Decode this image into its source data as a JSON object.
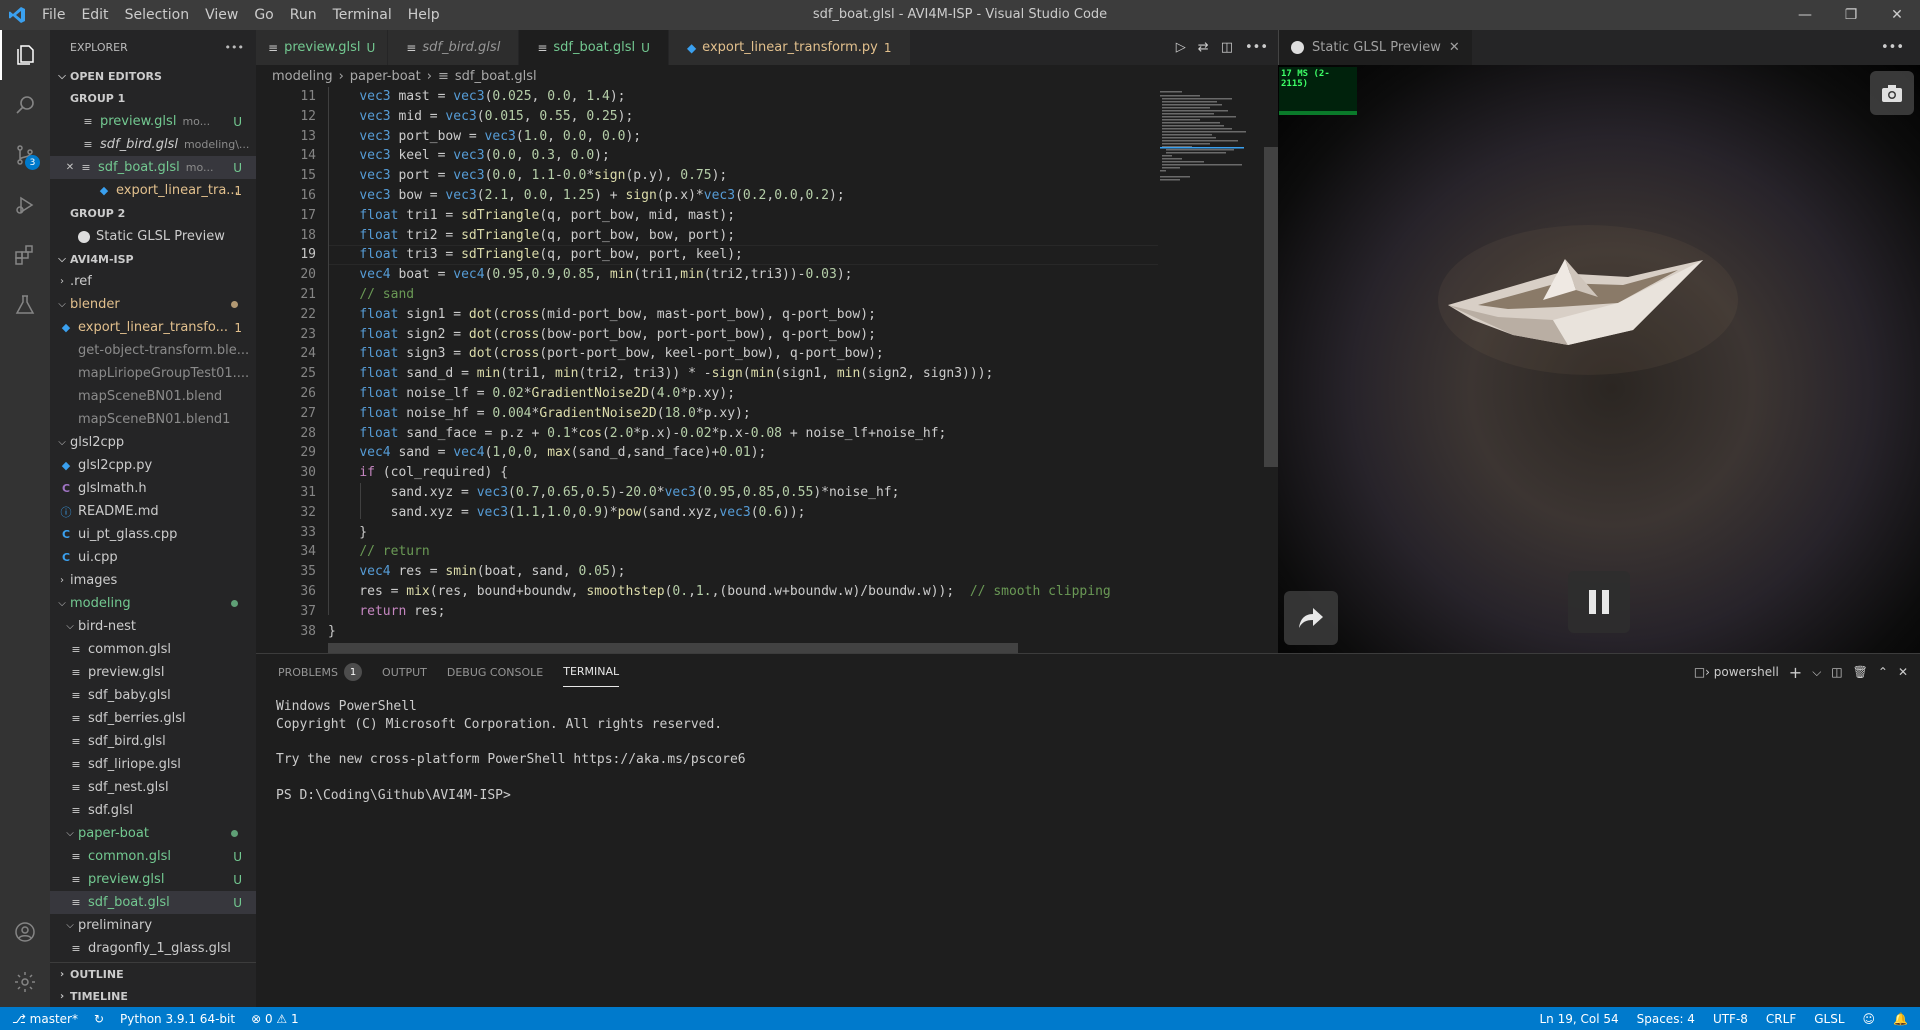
{
  "window": {
    "title": "sdf_boat.glsl - AVI4M-ISP - Visual Studio Code",
    "menu": [
      "File",
      "Edit",
      "Selection",
      "View",
      "Go",
      "Run",
      "Terminal",
      "Help"
    ]
  },
  "activity": {
    "scm_badge": "3"
  },
  "sidebar": {
    "title": "EXPLORER",
    "open_editors_label": "OPEN EDITORS",
    "group1_label": "GROUP 1",
    "group2_label": "GROUP 2",
    "open_editors": [
      {
        "name": "preview.glsl",
        "desc": "mo...",
        "badge": "U"
      },
      {
        "name": "sdf_bird.glsl",
        "desc": "modeling\\...",
        "badge": ""
      },
      {
        "name": "sdf_boat.glsl",
        "desc": "mo...",
        "badge": "U"
      },
      {
        "name": "export_linear_tra...",
        "desc": "",
        "badge": "1"
      }
    ],
    "group2_item": "Static GLSL Preview",
    "project_label": "AVI4M-ISP",
    "tree": [
      {
        "name": ".ref"
      },
      {
        "name": "blender"
      },
      {
        "name": "export_linear_transfo...",
        "badge": "1"
      },
      {
        "name": "get-object-transform.ble..."
      },
      {
        "name": "mapLiriopeGroupTest01...."
      },
      {
        "name": "mapSceneBN01.blend"
      },
      {
        "name": "mapSceneBN01.blend1"
      },
      {
        "name": "glsl2cpp"
      },
      {
        "name": "glsl2cpp.py"
      },
      {
        "name": "glslmath.h"
      },
      {
        "name": "README.md"
      },
      {
        "name": "ui_pt_glass.cpp"
      },
      {
        "name": "ui.cpp"
      },
      {
        "name": "images"
      },
      {
        "name": "modeling"
      },
      {
        "name": "bird-nest"
      },
      {
        "name": "common.glsl"
      },
      {
        "name": "preview.glsl"
      },
      {
        "name": "sdf_baby.glsl"
      },
      {
        "name": "sdf_berries.glsl"
      },
      {
        "name": "sdf_bird.glsl"
      },
      {
        "name": "sdf_liriope.glsl"
      },
      {
        "name": "sdf_nest.glsl"
      },
      {
        "name": "sdf.glsl"
      },
      {
        "name": "paper-boat"
      },
      {
        "name": "common.glsl",
        "badge": "U"
      },
      {
        "name": "preview.glsl",
        "badge": "U"
      },
      {
        "name": "sdf_boat.glsl",
        "badge": "U"
      },
      {
        "name": "preliminary"
      },
      {
        "name": "dragonfly_1_glass.glsl"
      }
    ],
    "outline_label": "OUTLINE",
    "timeline_label": "TIMELINE"
  },
  "tabs": [
    {
      "name": "preview.glsl",
      "mod": "U"
    },
    {
      "name": "sdf_bird.glsl",
      "mod": ""
    },
    {
      "name": "sdf_boat.glsl",
      "mod": "U"
    },
    {
      "name": "export_linear_transform.py",
      "mod": "1"
    }
  ],
  "breadcrumbs": [
    "modeling",
    "paper-boat",
    "sdf_boat.glsl"
  ],
  "code": {
    "line_numbers": [
      "11",
      "12",
      "13",
      "14",
      "15",
      "16",
      "17",
      "18",
      "19",
      "20",
      "21",
      "22",
      "23",
      "24",
      "25",
      "26",
      "27",
      "28",
      "29",
      "30",
      "31",
      "32",
      "33",
      "34",
      "35",
      "36",
      "37",
      "38"
    ],
    "current_line": "19",
    "lines": [
      "    vec3 mast = vec3(0.025, 0.0, 1.4);",
      "    vec3 mid = vec3(0.015, 0.55, 0.25);",
      "    vec3 port_bow = vec3(1.0, 0.0, 0.0);",
      "    vec3 keel = vec3(0.0, 0.3, 0.0);",
      "    vec3 port = vec3(0.0, 1.1-0.0*sign(p.y), 0.75);",
      "    vec3 bow = vec3(2.1, 0.0, 1.25) + sign(p.x)*vec3(0.2,0.0,0.2);",
      "    float tri1 = sdTriangle(q, port_bow, mid, mast);",
      "    float tri2 = sdTriangle(q, port_bow, bow, port);",
      "    float tri3 = sdTriangle(q, port_bow, port, keel);",
      "    vec4 boat = vec4(0.95,0.9,0.85, min(tri1,min(tri2,tri3))-0.03);",
      "    // sand",
      "    float sign1 = dot(cross(mid-port_bow, mast-port_bow), q-port_bow);",
      "    float sign2 = dot(cross(bow-port_bow, port-port_bow), q-port_bow);",
      "    float sign3 = dot(cross(port-port_bow, keel-port_bow), q-port_bow);",
      "    float sand_d = min(tri1, min(tri2, tri3)) * -sign(min(sign1, min(sign2, sign3)));",
      "    float noise_lf = 0.02*GradientNoise2D(4.0*p.xy);",
      "    float noise_hf = 0.004*GradientNoise2D(18.0*p.xy);",
      "    float sand_face = p.z + 0.1*cos(2.0*p.x)-0.02*p.x-0.08 + noise_lf+noise_hf;",
      "    vec4 sand = vec4(1,0,0, max(sand_d,sand_face)+0.01);",
      "    if (col_required) {",
      "        sand.xyz = vec3(0.7,0.65,0.5)-20.0*vec3(0.95,0.85,0.55)*noise_hf;",
      "        sand.xyz = vec3(1.1,1.0,0.9)*pow(sand.xyz,vec3(0.6));",
      "    }",
      "    // return",
      "    vec4 res = smin(boat, sand, 0.05);",
      "    res = mix(res, bound+boundw, smoothstep(0.,1.,(bound.w+boundw.w)/boundw.w));  // smooth clipping",
      "    return res;",
      "}"
    ]
  },
  "preview": {
    "tab_label": "Static GLSL Preview",
    "fps_text": "17 MS (2-2115)"
  },
  "panel": {
    "tabs": [
      "PROBLEMS",
      "OUTPUT",
      "DEBUG CONSOLE",
      "TERMINAL"
    ],
    "problems_count": "1",
    "shell": "powershell",
    "terminal_lines": [
      "Windows PowerShell",
      "Copyright (C) Microsoft Corporation. All rights reserved.",
      "",
      "Try the new cross-platform PowerShell https://aka.ms/pscore6",
      "",
      "PS D:\\Coding\\Github\\AVI4M-ISP>"
    ]
  },
  "status": {
    "branch": "master*",
    "python": "Python 3.9.1 64-bit",
    "errors": "0",
    "warnings": "1",
    "position": "Ln 19, Col 54",
    "spaces": "Spaces: 4",
    "encoding": "UTF-8",
    "eol": "CRLF",
    "language": "GLSL"
  }
}
